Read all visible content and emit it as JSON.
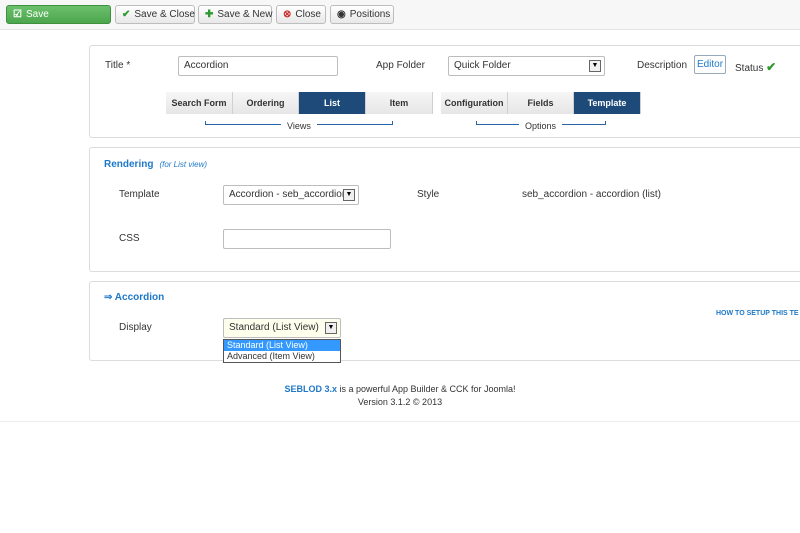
{
  "toolbar": {
    "save": "Save",
    "save_close": "Save & Close",
    "save_new": "Save & New",
    "close": "Close",
    "positions": "Positions"
  },
  "header": {
    "title_label": "Title",
    "required_mark": "*",
    "title_value": "Accordion",
    "app_folder_label": "App Folder",
    "app_folder_value": "Quick Folder",
    "description_label": "Description",
    "editor_button": "Editor",
    "status_label": "Status",
    "status_icon": "check-icon"
  },
  "tabs": {
    "views": [
      "Search Form",
      "Ordering",
      "List",
      "Item"
    ],
    "options": [
      "Configuration",
      "Fields",
      "Template"
    ],
    "views_label": "Views",
    "options_label": "Options",
    "active_view": "List",
    "active_option": "Template"
  },
  "rendering": {
    "title": "Rendering",
    "note": "(for List view)",
    "template_label": "Template",
    "template_value": "Accordion - seb_accordion",
    "style_label": "Style",
    "style_value": "seb_accordion - accordion (list)",
    "css_label": "CSS",
    "css_value": ""
  },
  "accordion": {
    "title": "⇒ Accordion",
    "display_label": "Display",
    "display_value": "Standard (List View)",
    "options": [
      "Standard (List View)",
      "Advanced (Item View)"
    ],
    "help_link": "HOW TO SETUP THIS TE"
  },
  "footer": {
    "brand": "SEBLOD 3.x",
    "tagline": " is a powerful App Builder & CCK for Joomla!",
    "version": "Version 3.1.2 © 2013"
  },
  "colors": {
    "accent": "#1e78c8",
    "active_tab": "#1e4a7a",
    "save_green": "#4ca64c"
  }
}
